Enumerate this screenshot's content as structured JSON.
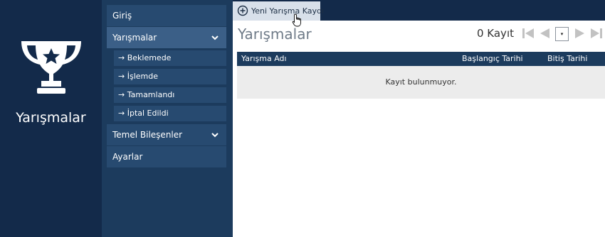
{
  "module": {
    "title": "Yarışmalar"
  },
  "sidebar": {
    "items": [
      {
        "label": "Giriş"
      },
      {
        "label": "Yarışmalar"
      },
      {
        "label": "Temel Bileşenler"
      },
      {
        "label": "Ayarlar"
      }
    ],
    "subitems": [
      {
        "label": "→ Beklemede"
      },
      {
        "label": "→ İşlemde"
      },
      {
        "label": "→ Tamamlandı"
      },
      {
        "label": "→ İptal Edildi"
      }
    ]
  },
  "toolbar": {
    "new_label": "Yeni Yarışma Kaydı"
  },
  "main": {
    "title": "Yarışmalar",
    "count_label": "0 Kayıt",
    "pager_select": "▾"
  },
  "table": {
    "columns": [
      "Yarışma Adı",
      "Başlangıç Tarihi",
      "Bitiş Tarihi"
    ],
    "empty_message": "Kayıt bulunmuyor."
  },
  "colors": {
    "dark_navy": "#132a4a",
    "sidebar": "#1c3b5d",
    "nav_item": "#274a70",
    "active": "#3b5f87"
  }
}
